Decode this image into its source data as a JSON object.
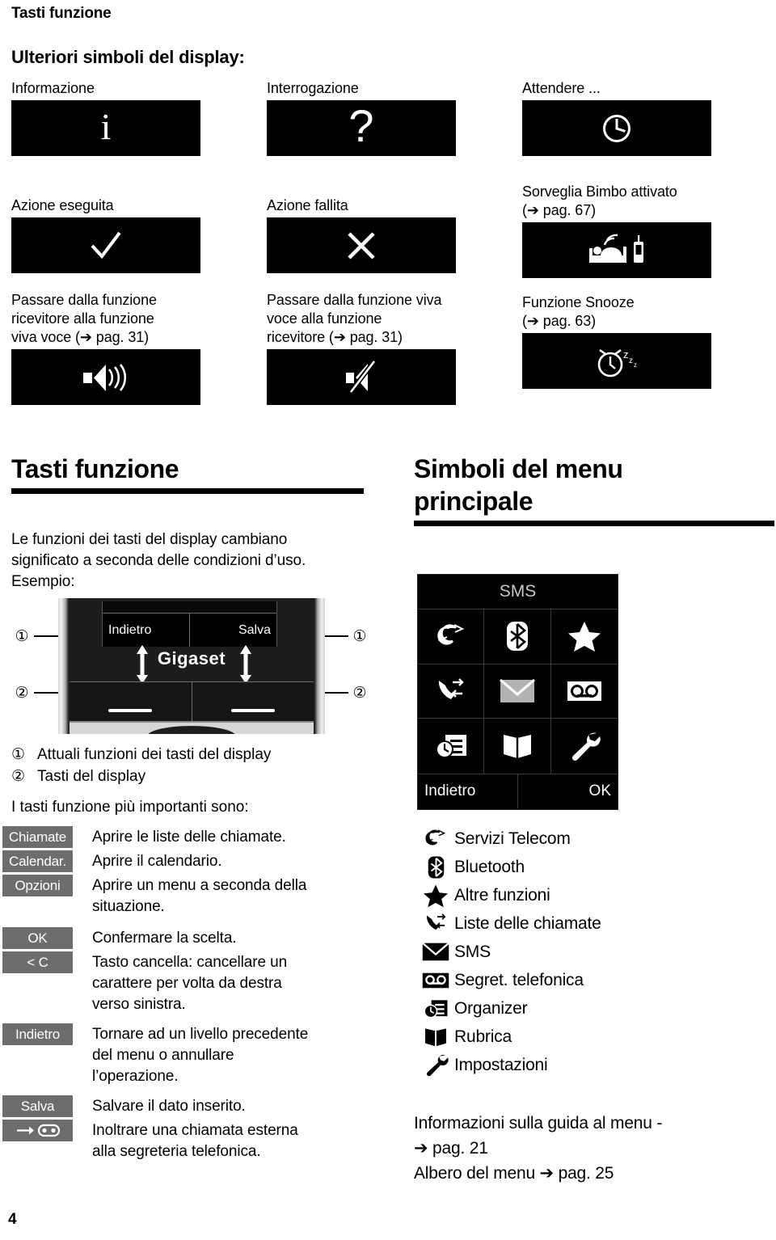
{
  "running_head": "Tasti funzione",
  "subhead": "Ulteriori simboli del display:",
  "symbols": [
    {
      "caption": "Informazione",
      "icon": "info-icon",
      "col": 1,
      "row": 1
    },
    {
      "caption": "Interrogazione",
      "icon": "question-mark-icon",
      "col": 2,
      "row": 1
    },
    {
      "caption": "Attendere ...",
      "icon": "clock-icon",
      "col": 3,
      "row": 1
    },
    {
      "caption": "Azione eseguita",
      "icon": "checkmark-icon",
      "col": 1,
      "row": 2
    },
    {
      "caption": "Azione fallita",
      "icon": "cross-icon",
      "col": 2,
      "row": 2
    },
    {
      "caption": "Sorveglia Bimbo attivato\n(➔ pag. 67)",
      "icon": "baby-monitor-icon",
      "col": 3,
      "row": 2
    },
    {
      "caption": "Passare dalla funzione\nricevitore alla funzione\nviva voce (➔ pag. 31)",
      "icon": "speaker-on-icon",
      "col": 1,
      "row": 3
    },
    {
      "caption": "Passare dalla funzione viva\nvoce alla funzione\nricevitore (➔ pag. 31)",
      "icon": "speaker-off-icon",
      "col": 2,
      "row": 3
    },
    {
      "caption": "Funzione Snooze\n(➔ pag. 63)",
      "icon": "snooze-alarm-icon",
      "col": 3,
      "row": 3
    }
  ],
  "left_section": {
    "title": "Tasti funzione",
    "intro": "Le funzioni dei tasti del display cambiano\nsignificato a seconda delle condizioni d’uso.\nEsempio:",
    "handset": {
      "softkey_left": "Indietro",
      "softkey_right": "Salva",
      "brand": "Gigaset",
      "callout_left_top": "①",
      "callout_right_top": "①",
      "callout_left_bottom": "②",
      "callout_right_bottom": "②"
    },
    "callouts": [
      {
        "num": "①",
        "text": "Attuali funzioni dei tasti del display"
      },
      {
        "num": "②",
        "text": "Tasti del display"
      }
    ],
    "keys_intro": "I tasti funzione più importanti sono:",
    "keys": [
      {
        "key": "Chiamate",
        "icon": null,
        "desc": "Aprire le liste delle chiamate."
      },
      {
        "key": "Calendar.",
        "icon": null,
        "desc": "Aprire il calendario."
      },
      {
        "key": "Opzioni",
        "icon": null,
        "desc": "Aprire un menu a seconda della\nsituazione."
      },
      {
        "key": "OK",
        "icon": null,
        "desc": "Confermare la scelta."
      },
      {
        "key": "< C",
        "icon": null,
        "desc": "Tasto cancella: cancellare un\ncarattere per volta da destra\nverso sinistra."
      },
      {
        "key": "Indietro",
        "icon": null,
        "desc": "Tornare ad un livello precedente\ndel menu o annullare\nl’operazione."
      },
      {
        "key": "Salva",
        "icon": null,
        "desc": "Salvare il dato inserito."
      },
      {
        "key": "",
        "icon": "forward-to-answering-machine-icon",
        "desc": "Inoltrare una chiamata esterna\nalla segreteria telefonica."
      }
    ]
  },
  "right_section": {
    "title": "Simboli del menu\nprincipale",
    "display": {
      "title": "SMS",
      "grid_icons": [
        "telecom-services-icon",
        "bluetooth-icon",
        "star-icon",
        "call-lists-icon",
        "sms-envelope-icon",
        "answering-machine-icon",
        "organizer-icon",
        "phonebook-icon",
        "settings-wrench-icon"
      ],
      "softkey_left": "Indietro",
      "softkey_right": "OK"
    },
    "legend": [
      {
        "icon": "telecom-services-icon",
        "label": "Servizi Telecom"
      },
      {
        "icon": "bluetooth-icon",
        "label": "Bluetooth"
      },
      {
        "icon": "star-icon",
        "label": "Altre funzioni"
      },
      {
        "icon": "call-lists-icon",
        "label": "Liste delle chiamate"
      },
      {
        "icon": "sms-envelope-icon",
        "label": "SMS"
      },
      {
        "icon": "answering-machine-icon",
        "label": "Segret. telefonica"
      },
      {
        "icon": "organizer-icon",
        "label": "Organizer"
      },
      {
        "icon": "phonebook-icon",
        "label": "Rubrica"
      },
      {
        "icon": "settings-wrench-icon",
        "label": "Impostazioni"
      }
    ],
    "refs": "Informazioni sulla guida al menu -\n➔  pag. 21\nAlbero del menu ➔  pag. 25"
  },
  "folio": "4",
  "colors": {
    "display_black": "#000000",
    "key_gray": "#6d6d6d",
    "paper": "#ffffff",
    "muted_text": "#c9c9c9"
  }
}
